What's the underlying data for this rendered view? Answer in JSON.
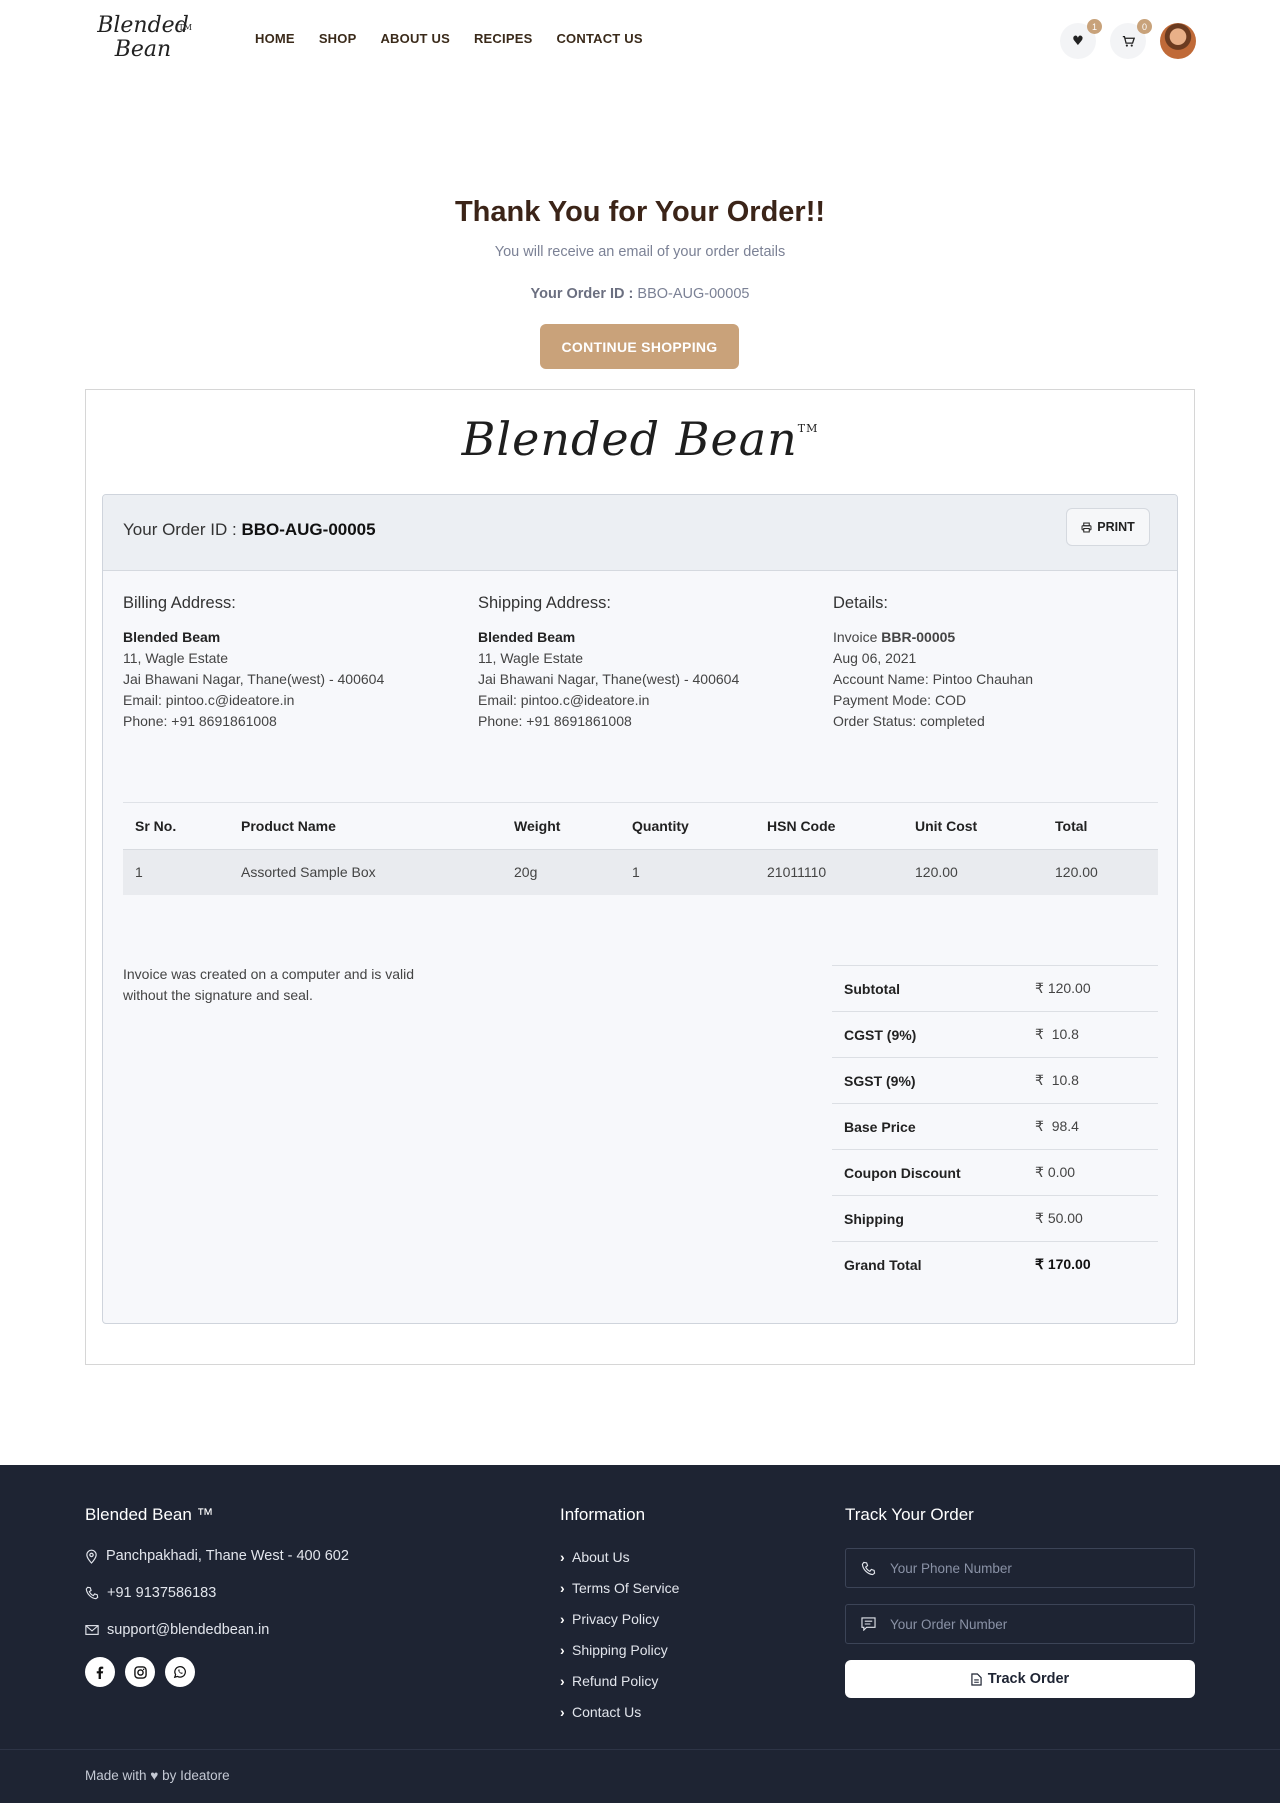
{
  "brand": {
    "logo_text_line1": "Blended",
    "logo_text_line2": "Bean",
    "logo_full": "Blended Bean",
    "tm": "TM"
  },
  "nav": {
    "items": [
      "HOME",
      "SHOP",
      "ABOUT US",
      "RECIPES",
      "CONTACT US"
    ]
  },
  "header": {
    "wishlist_count": "1",
    "cart_count": "0"
  },
  "thanks": {
    "title": "Thank You for Your Order!!",
    "subtitle": "You will receive an email of your order details",
    "order_id_label": "Your Order ID :",
    "order_id": "BBO-AUG-00005",
    "continue_button": "CONTINUE SHOPPING"
  },
  "invoice": {
    "order_id_label": "Your Order ID :",
    "order_id": "BBO-AUG-00005",
    "print_button": "PRINT",
    "billing": {
      "heading": "Billing Address:",
      "name": "Blended Beam",
      "line1": "11, Wagle Estate",
      "line2": "Jai Bhawani Nagar, Thane(west) - 400604",
      "email": "Email: pintoo.c@ideatore.in",
      "phone": "Phone: +91 8691861008"
    },
    "shipping": {
      "heading": "Shipping Address:",
      "name": "Blended Beam",
      "line1": "11, Wagle Estate",
      "line2": "Jai Bhawani Nagar, Thane(west) - 400604",
      "email": "Email: pintoo.c@ideatore.in",
      "phone": "Phone: +91 8691861008"
    },
    "details": {
      "heading": "Details:",
      "invoice_label": "Invoice",
      "invoice_no": "BBR-00005",
      "date": "Aug 06, 2021",
      "account": "Account Name: Pintoo Chauhan",
      "payment": "Payment Mode: COD",
      "status": "Order Status: completed"
    },
    "table": {
      "headers": [
        "Sr No.",
        "Product Name",
        "Weight",
        "Quantity",
        "HSN Code",
        "Unit Cost",
        "Total"
      ],
      "rows": [
        [
          "1",
          "Assorted Sample Box",
          "20g",
          "1",
          "21011110",
          "120.00",
          "120.00"
        ]
      ]
    },
    "note": "Invoice was created on a computer and is valid without the signature and seal.",
    "currency": "₹",
    "totals": [
      {
        "label": "Subtotal",
        "value": "120.00"
      },
      {
        "label": "CGST (9%)",
        "value": "10.8"
      },
      {
        "label": "SGST (9%)",
        "value": "10.8"
      },
      {
        "label": "Base Price",
        "value": "98.4"
      },
      {
        "label": "Coupon Discount",
        "value": "0.00"
      },
      {
        "label": "Shipping",
        "value": "50.00"
      },
      {
        "label": "Grand Total",
        "value": "170.00"
      }
    ]
  },
  "footer": {
    "brand_title": "Blended Bean ™",
    "address": "Panchpakhadi, Thane West - 400 602",
    "phone": "+91 9137586183",
    "email": "support@blendedbean.in",
    "info_title": "Information",
    "info_links": [
      "About Us",
      "Terms Of Service",
      "Privacy Policy",
      "Shipping Policy",
      "Refund Policy",
      "Contact Us"
    ],
    "track_title": "Track Your Order",
    "phone_placeholder": "Your Phone Number",
    "order_placeholder": "Your Order Number",
    "track_button": "Track Order",
    "made_with": "Made with",
    "made_by": "by Ideatore"
  },
  "colors": {
    "accent": "#c9a27a",
    "footer_bg": "#1e2433",
    "title_brown": "#3b2418"
  }
}
